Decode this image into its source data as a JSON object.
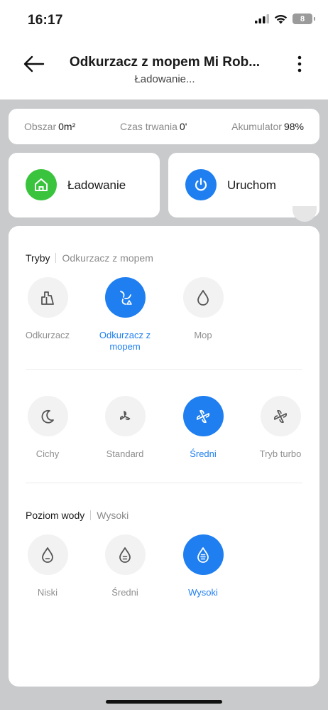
{
  "status_bar": {
    "time": "16:17",
    "battery": "8"
  },
  "header": {
    "title": "Odkurzacz z mopem Mi Rob...",
    "subtitle": "Ładowanie..."
  },
  "stats": {
    "area_label": "Obszar",
    "area_value": "0m²",
    "duration_label": "Czas trwania",
    "duration_value": "0'",
    "battery_label": "Akumulator",
    "battery_value": "98%"
  },
  "actions": {
    "charge_label": "Ładowanie",
    "start_label": "Uruchom"
  },
  "modes": {
    "title": "Tryby",
    "value": "Odkurzacz z mopem",
    "items": [
      {
        "label": "Odkurzacz",
        "icon": "vacuum-icon",
        "active": false
      },
      {
        "label": "Odkurzacz z mopem",
        "icon": "vacuum-mop-icon",
        "active": true
      },
      {
        "label": "Mop",
        "icon": "water-drop-icon",
        "active": false
      }
    ]
  },
  "suction": {
    "items": [
      {
        "label": "Cichy",
        "icon": "moon-icon",
        "active": false
      },
      {
        "label": "Standard",
        "icon": "fan-icon",
        "active": false
      },
      {
        "label": "Średni",
        "icon": "fan-icon",
        "active": true
      },
      {
        "label": "Tryb turbo",
        "icon": "fan-turbo-icon",
        "active": false
      }
    ]
  },
  "water": {
    "title": "Poziom wody",
    "value": "Wysoki",
    "items": [
      {
        "label": "Niski",
        "icon": "water-low-icon",
        "active": false
      },
      {
        "label": "Średni",
        "icon": "water-medium-icon",
        "active": false
      },
      {
        "label": "Wysoki",
        "icon": "water-high-icon",
        "active": true
      }
    ]
  },
  "colors": {
    "accent": "#1f7ff0",
    "green": "#3ac43e",
    "inactive_text": "#8f8f8f"
  }
}
